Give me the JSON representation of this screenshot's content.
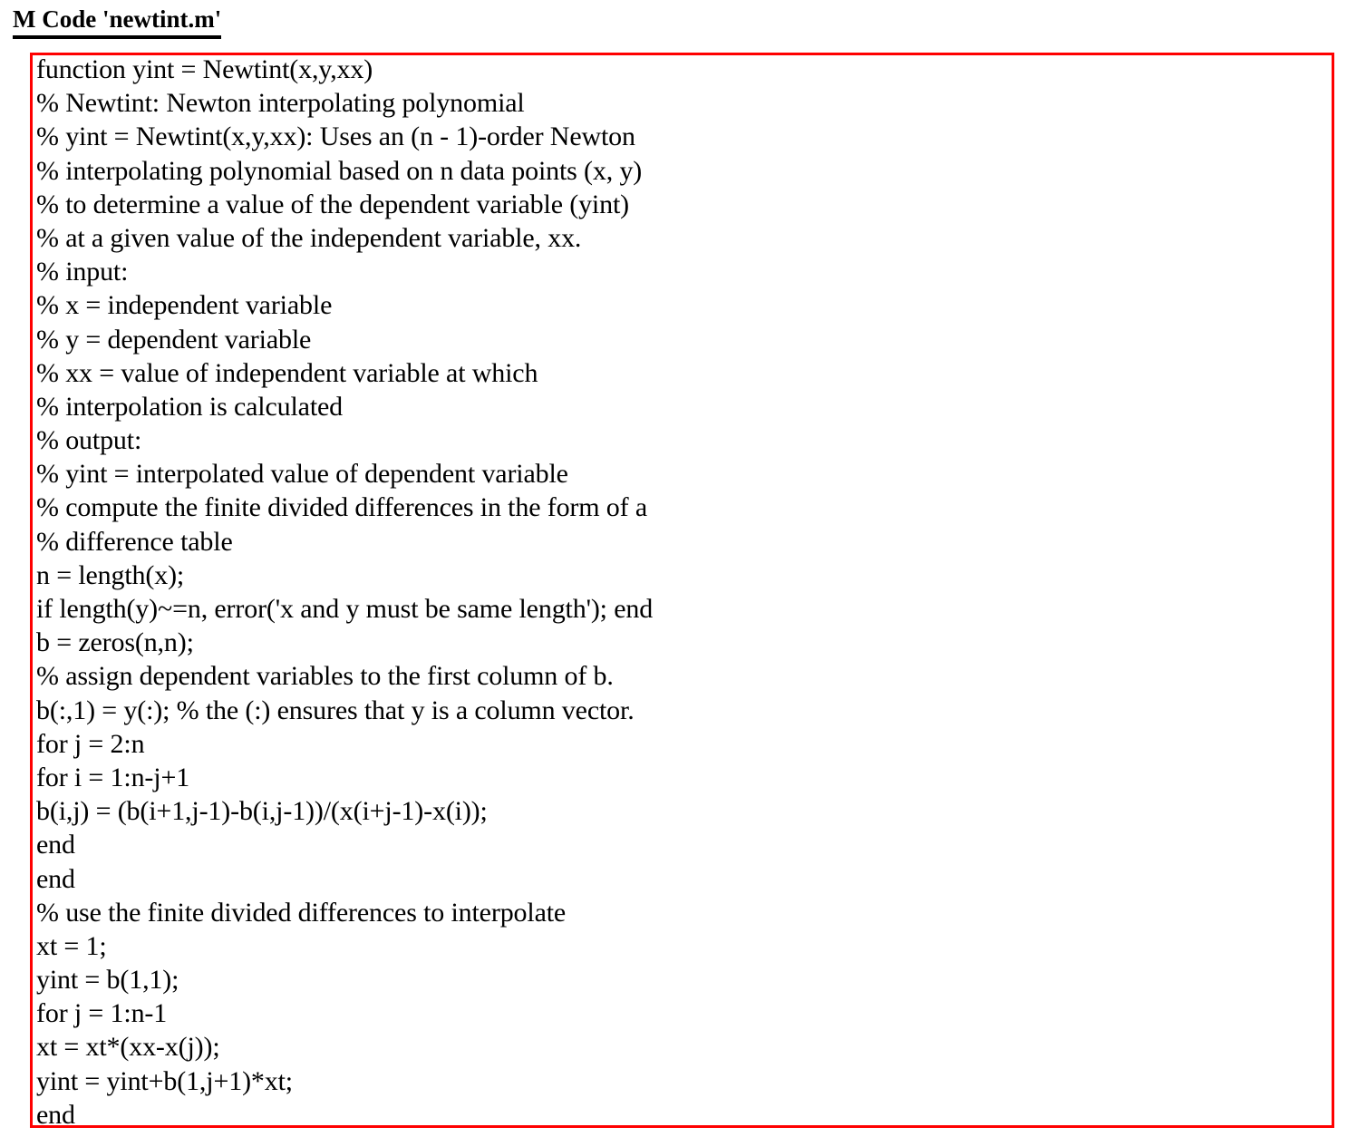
{
  "document": {
    "title": "M Code 'newtint.m'",
    "background_color": "#ffffff",
    "text_color": "#000000"
  },
  "code_box": {
    "border_color": "#ff0000",
    "background_color": "#ffffff",
    "language": "MATLAB",
    "lines": [
      "function yint = Newtint(x,y,xx)",
      "% Newtint: Newton interpolating polynomial",
      "% yint = Newtint(x,y,xx): Uses an (n - 1)-order Newton",
      "% interpolating polynomial based on n data points (x, y)",
      "% to determine a value of the dependent variable (yint)",
      "% at a given value of the independent variable, xx.",
      "% input:",
      "% x = independent variable",
      "% y = dependent variable",
      "% xx = value of independent variable at which",
      "% interpolation is calculated",
      "% output:",
      "% yint = interpolated value of dependent variable",
      "% compute the finite divided differences in the form of a",
      "% difference table",
      "n = length(x);",
      "if length(y)~=n, error('x and y must be same length'); end",
      "b = zeros(n,n);",
      "% assign dependent variables to the first column of b.",
      "b(:,1) = y(:); % the (:) ensures that y is a column vector.",
      "for j = 2:n",
      "for i = 1:n-j+1",
      "b(i,j) = (b(i+1,j-1)-b(i,j-1))/(x(i+j-1)-x(i));",
      "end",
      "end",
      "% use the finite divided differences to interpolate",
      "xt = 1;",
      "yint = b(1,1);",
      "for j = 1:n-1",
      "xt = xt*(xx-x(j));",
      "yint = yint+b(1,j+1)*xt;",
      "end"
    ]
  }
}
